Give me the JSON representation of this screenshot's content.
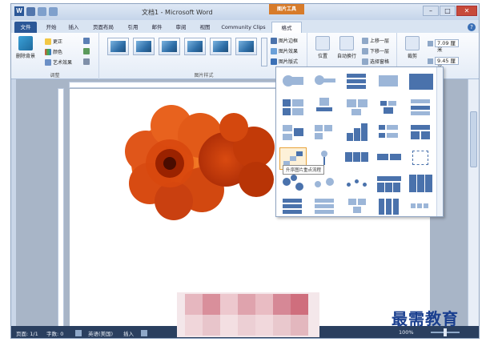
{
  "window": {
    "title": "文档1 - Microsoft Word",
    "context_tab_header": "图片工具"
  },
  "qat": {
    "logo": "W"
  },
  "tabs": [
    {
      "label": "文件",
      "active": false,
      "file": true
    },
    {
      "label": "开始"
    },
    {
      "label": "插入"
    },
    {
      "label": "页面布局"
    },
    {
      "label": "引用"
    },
    {
      "label": "邮件"
    },
    {
      "label": "审阅"
    },
    {
      "label": "视图"
    },
    {
      "label": "Community Clips"
    },
    {
      "label": "格式",
      "active": true
    }
  ],
  "ribbon": {
    "adjust_group": {
      "label": "调整",
      "remove_background": "删除背景",
      "corrections": "更正",
      "color": "颜色",
      "artistic_effects": "艺术效果"
    },
    "styles_group": {
      "label": "图片样式",
      "border": "图片边框",
      "effects": "图片效果",
      "layout": "图片版式"
    },
    "arrange_group": {
      "position": "位置",
      "wrap": "自动换行",
      "bring_forward": "上移一层",
      "send_backward": "下移一层",
      "selection_pane": "选择窗格"
    },
    "size_group": {
      "crop": "裁剪",
      "height": "7.09 厘米",
      "width": "9.45 厘米"
    }
  },
  "gallery": {
    "tooltip": "升序图片重点流程"
  },
  "statusbar": {
    "page": "页面: 1/1",
    "words": "字数: 0",
    "language": "英语(美国)",
    "insert_mode": "插入",
    "zoom": "100%"
  },
  "watermark": "最需教育"
}
